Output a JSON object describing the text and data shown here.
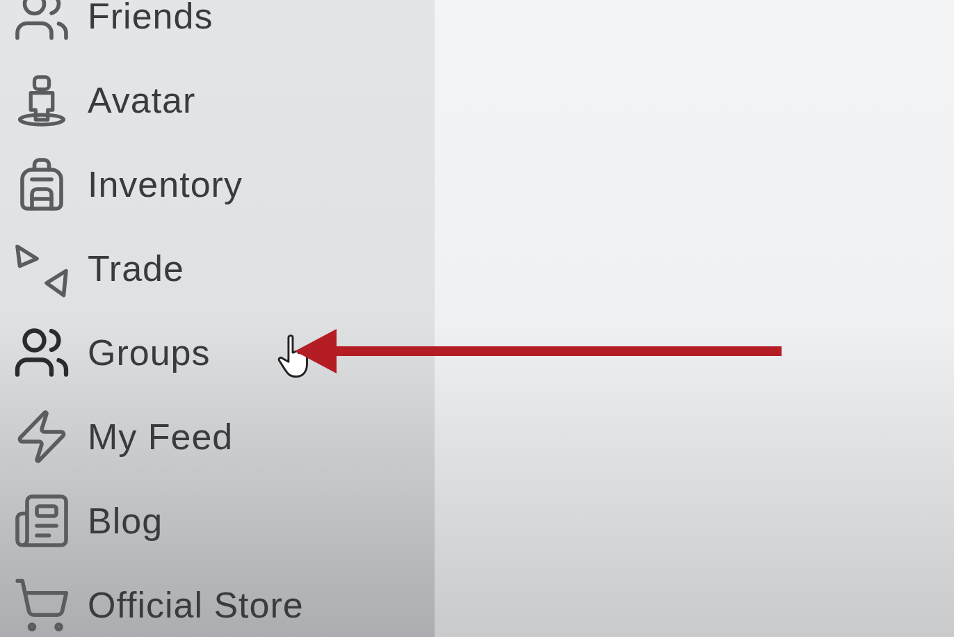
{
  "sidebar": {
    "items": [
      {
        "kind": "friends",
        "label": "Friends"
      },
      {
        "kind": "avatar",
        "label": "Avatar"
      },
      {
        "kind": "inventory",
        "label": "Inventory"
      },
      {
        "kind": "trade",
        "label": "Trade"
      },
      {
        "kind": "groups",
        "label": "Groups"
      },
      {
        "kind": "feed",
        "label": "My Feed"
      },
      {
        "kind": "blog",
        "label": "Blog"
      },
      {
        "kind": "store",
        "label": "Official Store"
      }
    ]
  }
}
